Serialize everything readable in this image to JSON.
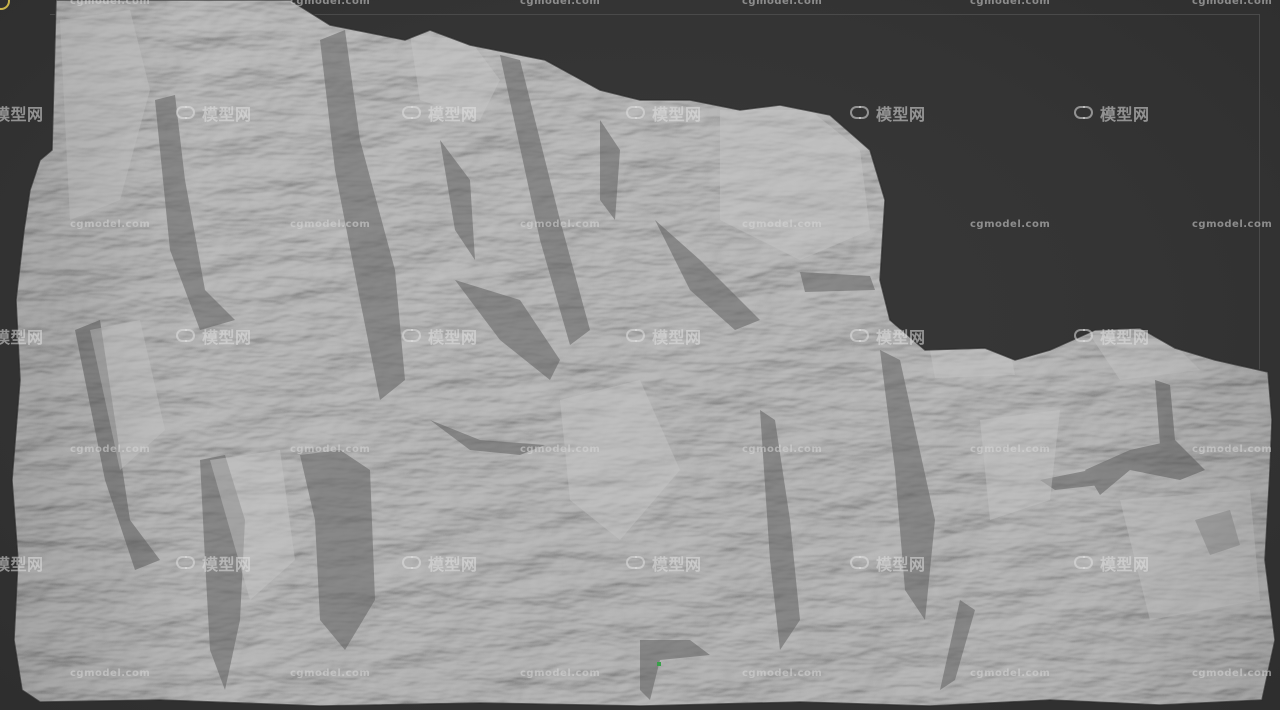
{
  "viewport": {
    "background": "#333333",
    "model_fill": "#8d8d8d",
    "model_highlight": "#c8c8c8",
    "model_shadow": "#2a2a2a"
  },
  "watermarks": {
    "url_text": "cgmodel.com",
    "brand_text": "模型网",
    "brand_icon": "cg-logo-icon"
  },
  "tool_widget": {
    "icon": "gizmo-ring-icon",
    "color": "#c9b44a"
  }
}
